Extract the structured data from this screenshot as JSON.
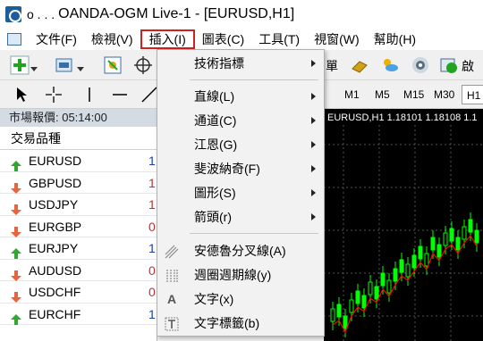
{
  "window": {
    "title": "OANDA-OGM Live-1 - [EURUSD,H1]"
  },
  "menubar": {
    "items": [
      {
        "label": "文件(F)"
      },
      {
        "label": "檢視(V)"
      },
      {
        "label": "插入(I)"
      },
      {
        "label": "圖表(C)"
      },
      {
        "label": "工具(T)"
      },
      {
        "label": "視窗(W)"
      },
      {
        "label": "幫助(H)"
      }
    ]
  },
  "toolbar": {
    "partial_label_1": "單",
    "partial_label_2": "啟",
    "timeframes": [
      "M1",
      "M5",
      "M15",
      "M30",
      "H1"
    ],
    "selected_timeframe": "H1"
  },
  "insert_menu": {
    "items": [
      {
        "label": "技術指標",
        "submenu": true
      },
      {
        "label": "直線(L)",
        "submenu": true
      },
      {
        "label": "通道(C)",
        "submenu": true
      },
      {
        "label": "江恩(G)",
        "submenu": true
      },
      {
        "label": "斐波納奇(F)",
        "submenu": true
      },
      {
        "label": "圖形(S)",
        "submenu": true
      },
      {
        "label": "箭頭(r)",
        "submenu": true
      },
      {
        "label": "安德魯分叉線(A)",
        "submenu": false,
        "icon": "andrews-pitchfork-icon"
      },
      {
        "label": "週圈週期線(y)",
        "submenu": false,
        "icon": "cycle-lines-icon"
      },
      {
        "label": "文字(x)",
        "submenu": false,
        "icon": "text-icon"
      },
      {
        "label": "文字標籤(b)",
        "submenu": false,
        "icon": "text-label-icon"
      }
    ]
  },
  "market_watch": {
    "header": "市場報價: 05:14:00",
    "column_symbol": "交易品種",
    "rows": [
      {
        "symbol": "EURUSD",
        "direction": "up",
        "bid_partial": "1"
      },
      {
        "symbol": "GBPUSD",
        "direction": "down",
        "bid_partial": "1"
      },
      {
        "symbol": "USDJPY",
        "direction": "down",
        "bid_partial": "1"
      },
      {
        "symbol": "EURGBP",
        "direction": "down",
        "bid_partial": "0"
      },
      {
        "symbol": "EURJPY",
        "direction": "up",
        "bid_partial": "1"
      },
      {
        "symbol": "AUDUSD",
        "direction": "down",
        "bid_partial": "0"
      },
      {
        "symbol": "USDCHF",
        "direction": "down",
        "bid_partial": "0"
      },
      {
        "symbol": "EURCHF",
        "direction": "up",
        "bid_partial": "1"
      }
    ]
  },
  "chart": {
    "label": "EURUSD,H1  1.18101 1.18108 1.1",
    "background": "#000000",
    "candle_color": "#00ff00",
    "ma_color": "#ff0000"
  },
  "colors": {
    "up_arrow": "#2fa82f",
    "down_arrow": "#e8643c",
    "active_menu_border": "#d02020"
  }
}
